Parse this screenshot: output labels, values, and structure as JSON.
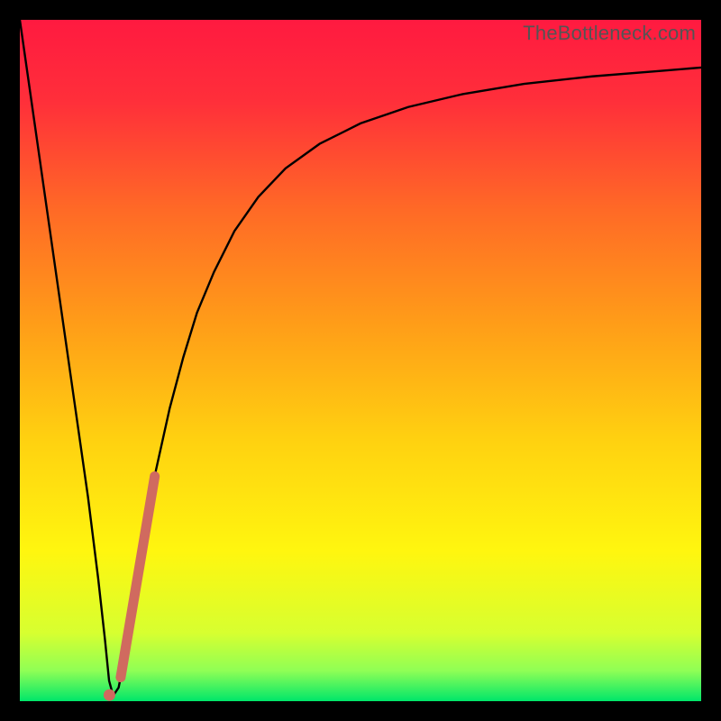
{
  "watermark": "TheBottleneck.com",
  "chart_data": {
    "type": "line",
    "title": "",
    "xlabel": "",
    "ylabel": "",
    "xlim": [
      0,
      100
    ],
    "ylim": [
      0,
      100
    ],
    "grid": false,
    "legend": false,
    "gradient_stops": [
      {
        "offset": 0.0,
        "color": "#ff1a40"
      },
      {
        "offset": 0.12,
        "color": "#ff2f3a"
      },
      {
        "offset": 0.28,
        "color": "#ff6a26"
      },
      {
        "offset": 0.45,
        "color": "#ff9e18"
      },
      {
        "offset": 0.62,
        "color": "#ffd210"
      },
      {
        "offset": 0.78,
        "color": "#fff60f"
      },
      {
        "offset": 0.9,
        "color": "#d7ff30"
      },
      {
        "offset": 0.955,
        "color": "#90ff55"
      },
      {
        "offset": 1.0,
        "color": "#00e66a"
      }
    ],
    "series": [
      {
        "name": "curve",
        "stroke": "#000000",
        "stroke_width": 2.4,
        "x": [
          0.0,
          2.0,
          4.0,
          6.0,
          8.0,
          10.0,
          11.5,
          12.5,
          13.1,
          13.7,
          14.5,
          15.5,
          17.0,
          18.5,
          20.0,
          22.0,
          24.0,
          26.0,
          28.5,
          31.5,
          35.0,
          39.0,
          44.0,
          50.0,
          57.0,
          65.0,
          74.0,
          84.0,
          94.0,
          100.0
        ],
        "y": [
          100.0,
          86.0,
          72.0,
          58.0,
          44.0,
          30.0,
          18.0,
          9.0,
          3.0,
          0.8,
          2.0,
          7.0,
          17.0,
          26.0,
          34.0,
          43.0,
          50.5,
          57.0,
          63.0,
          69.0,
          74.0,
          78.2,
          81.8,
          84.8,
          87.2,
          89.1,
          90.6,
          91.7,
          92.5,
          93.0
        ]
      },
      {
        "name": "highlight",
        "stroke": "#d06a5f",
        "stroke_width": 11,
        "linecap": "round",
        "x": [
          14.8,
          19.8
        ],
        "y": [
          3.5,
          33.0
        ]
      }
    ],
    "markers": [
      {
        "name": "min-dot",
        "x": 13.15,
        "y": 0.9,
        "r": 6.5,
        "fill": "#d06a5f"
      }
    ]
  }
}
